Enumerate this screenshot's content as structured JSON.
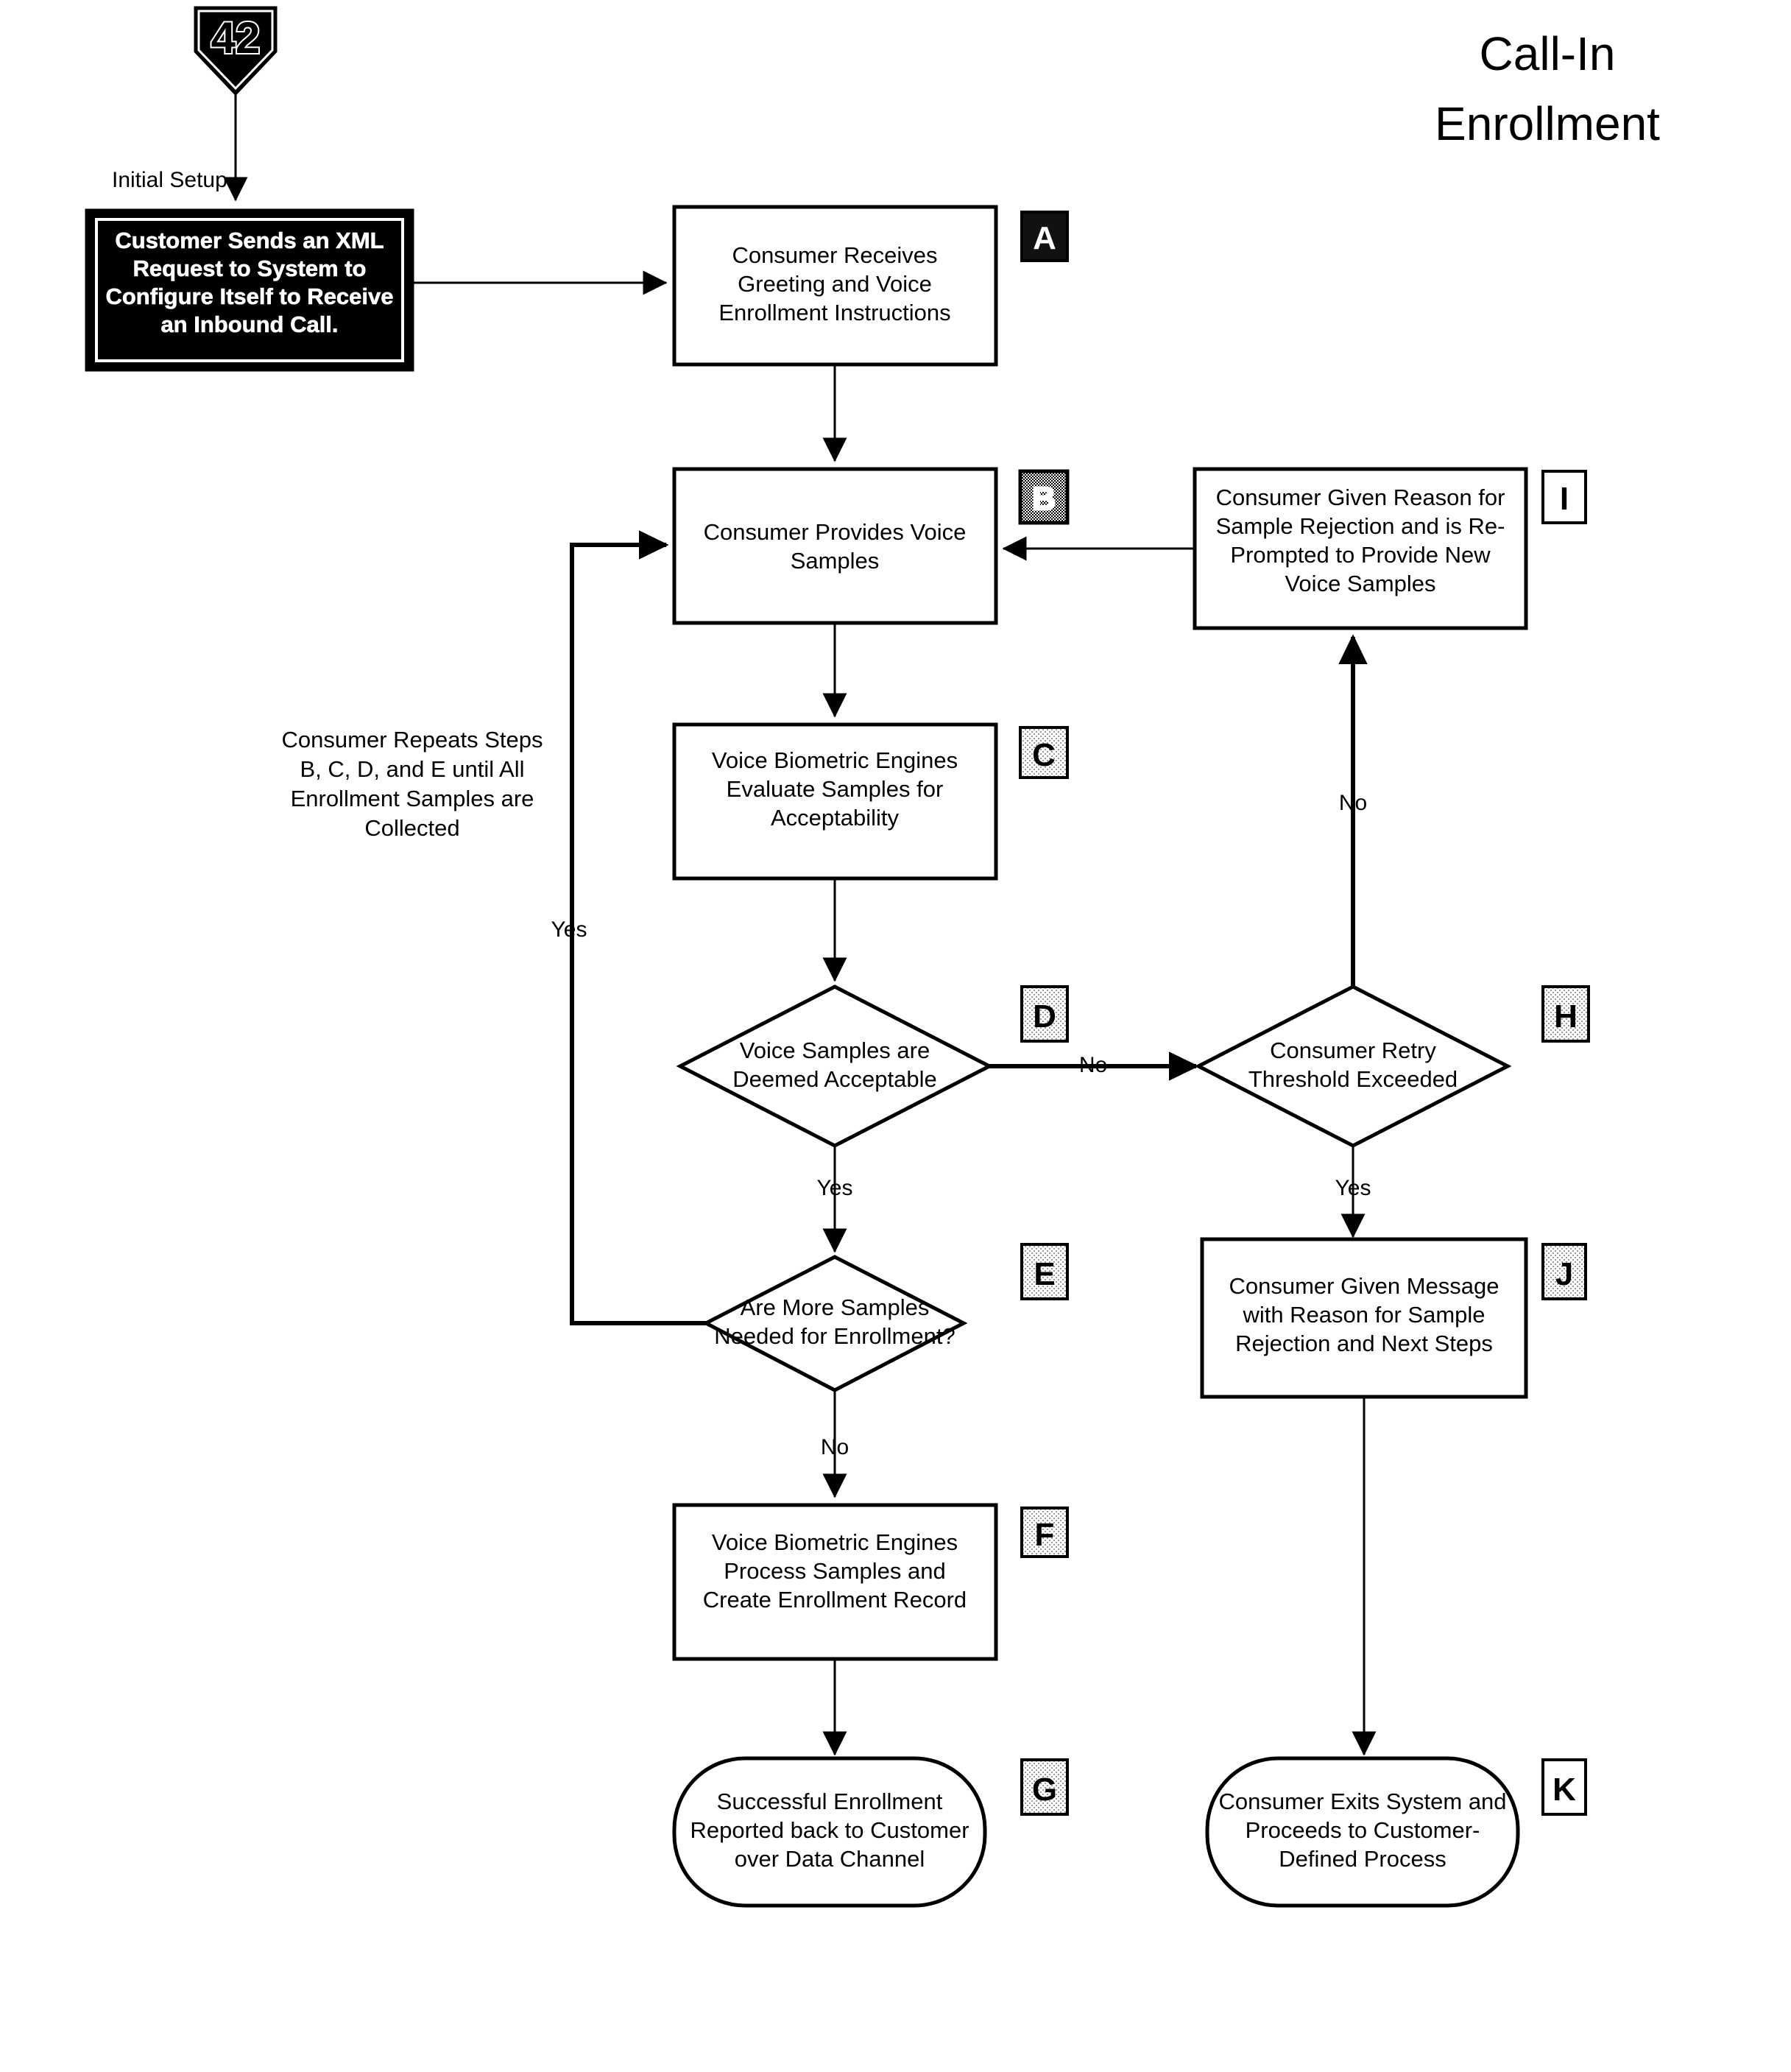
{
  "title": {
    "line1": "Call-In",
    "line2": "Enrollment"
  },
  "figure_marker": {
    "number": "42",
    "shape": "pentagon-home-plate"
  },
  "labels": {
    "initial_setup": "Initial Setup"
  },
  "annotation": {
    "loop_note_line1": "Consumer Repeats Steps",
    "loop_note_line2": "B, C, D, and E until All",
    "loop_note_line3": "Enrollment Samples are",
    "loop_note_line4": "Collected"
  },
  "nodes": {
    "setup": {
      "badge": "",
      "shape": "process-inverted",
      "lines": [
        "Customer Sends an XML",
        "Request to System to",
        "Configure Itself to Receive",
        "an Inbound Call."
      ]
    },
    "a": {
      "badge": "A",
      "shape": "process",
      "lines": [
        "Consumer Receives",
        "Greeting and Voice",
        "Enrollment Instructions"
      ]
    },
    "b": {
      "badge": "B",
      "shape": "process",
      "lines": [
        "Consumer Provides Voice",
        "Samples"
      ]
    },
    "c": {
      "badge": "C",
      "shape": "process",
      "lines": [
        "Voice Biometric Engines",
        "Evaluate Samples for",
        "Acceptability"
      ]
    },
    "d": {
      "badge": "D",
      "shape": "decision",
      "lines": [
        "Voice Samples are",
        "Deemed Acceptable"
      ]
    },
    "e": {
      "badge": "E",
      "shape": "decision",
      "lines": [
        "Are More Samples",
        "Needed for Enrollment?"
      ]
    },
    "f": {
      "badge": "F",
      "shape": "process",
      "lines": [
        "Voice Biometric Engines",
        "Process Samples and",
        "Create Enrollment Record"
      ]
    },
    "g": {
      "badge": "G",
      "shape": "terminator",
      "lines": [
        "Successful Enrollment",
        "Reported back to Customer",
        "over Data Channel"
      ]
    },
    "h": {
      "badge": "H",
      "shape": "decision",
      "lines": [
        "Consumer Retry",
        "Threshold Exceeded"
      ]
    },
    "i": {
      "badge": "I",
      "shape": "process",
      "lines": [
        "Consumer Given Reason for",
        "Sample Rejection and is Re-",
        "Prompted to Provide New",
        "Voice Samples"
      ]
    },
    "j": {
      "badge": "J",
      "shape": "process",
      "lines": [
        "Consumer Given Message",
        "with Reason for Sample",
        "Rejection and Next Steps"
      ]
    },
    "k": {
      "badge": "K",
      "shape": "terminator",
      "lines": [
        "Consumer Exits System and",
        "Proceeds to Customer-",
        "Defined Process"
      ]
    }
  },
  "edges": {
    "d_no": "No",
    "d_yes": "Yes",
    "e_no": "No",
    "e_yes": "Yes",
    "h_yes": "Yes",
    "h_no": "No"
  },
  "colors": {
    "ink": "#000000",
    "paper": "#ffffff",
    "badge_fill_light": "#d8d8d8",
    "badge_fill_dark": "#111111"
  }
}
